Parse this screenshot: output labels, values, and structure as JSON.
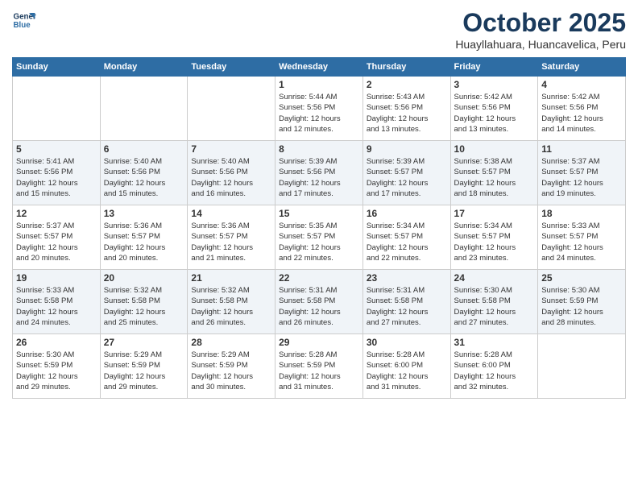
{
  "logo": {
    "line1": "General",
    "line2": "Blue"
  },
  "title": "October 2025",
  "subtitle": "Huayllahuara, Huancavelica, Peru",
  "days_of_week": [
    "Sunday",
    "Monday",
    "Tuesday",
    "Wednesday",
    "Thursday",
    "Friday",
    "Saturday"
  ],
  "weeks": [
    [
      {
        "day": "",
        "info": ""
      },
      {
        "day": "",
        "info": ""
      },
      {
        "day": "",
        "info": ""
      },
      {
        "day": "1",
        "info": "Sunrise: 5:44 AM\nSunset: 5:56 PM\nDaylight: 12 hours\nand 12 minutes."
      },
      {
        "day": "2",
        "info": "Sunrise: 5:43 AM\nSunset: 5:56 PM\nDaylight: 12 hours\nand 13 minutes."
      },
      {
        "day": "3",
        "info": "Sunrise: 5:42 AM\nSunset: 5:56 PM\nDaylight: 12 hours\nand 13 minutes."
      },
      {
        "day": "4",
        "info": "Sunrise: 5:42 AM\nSunset: 5:56 PM\nDaylight: 12 hours\nand 14 minutes."
      }
    ],
    [
      {
        "day": "5",
        "info": "Sunrise: 5:41 AM\nSunset: 5:56 PM\nDaylight: 12 hours\nand 15 minutes."
      },
      {
        "day": "6",
        "info": "Sunrise: 5:40 AM\nSunset: 5:56 PM\nDaylight: 12 hours\nand 15 minutes."
      },
      {
        "day": "7",
        "info": "Sunrise: 5:40 AM\nSunset: 5:56 PM\nDaylight: 12 hours\nand 16 minutes."
      },
      {
        "day": "8",
        "info": "Sunrise: 5:39 AM\nSunset: 5:56 PM\nDaylight: 12 hours\nand 17 minutes."
      },
      {
        "day": "9",
        "info": "Sunrise: 5:39 AM\nSunset: 5:57 PM\nDaylight: 12 hours\nand 17 minutes."
      },
      {
        "day": "10",
        "info": "Sunrise: 5:38 AM\nSunset: 5:57 PM\nDaylight: 12 hours\nand 18 minutes."
      },
      {
        "day": "11",
        "info": "Sunrise: 5:37 AM\nSunset: 5:57 PM\nDaylight: 12 hours\nand 19 minutes."
      }
    ],
    [
      {
        "day": "12",
        "info": "Sunrise: 5:37 AM\nSunset: 5:57 PM\nDaylight: 12 hours\nand 20 minutes."
      },
      {
        "day": "13",
        "info": "Sunrise: 5:36 AM\nSunset: 5:57 PM\nDaylight: 12 hours\nand 20 minutes."
      },
      {
        "day": "14",
        "info": "Sunrise: 5:36 AM\nSunset: 5:57 PM\nDaylight: 12 hours\nand 21 minutes."
      },
      {
        "day": "15",
        "info": "Sunrise: 5:35 AM\nSunset: 5:57 PM\nDaylight: 12 hours\nand 22 minutes."
      },
      {
        "day": "16",
        "info": "Sunrise: 5:34 AM\nSunset: 5:57 PM\nDaylight: 12 hours\nand 22 minutes."
      },
      {
        "day": "17",
        "info": "Sunrise: 5:34 AM\nSunset: 5:57 PM\nDaylight: 12 hours\nand 23 minutes."
      },
      {
        "day": "18",
        "info": "Sunrise: 5:33 AM\nSunset: 5:57 PM\nDaylight: 12 hours\nand 24 minutes."
      }
    ],
    [
      {
        "day": "19",
        "info": "Sunrise: 5:33 AM\nSunset: 5:58 PM\nDaylight: 12 hours\nand 24 minutes."
      },
      {
        "day": "20",
        "info": "Sunrise: 5:32 AM\nSunset: 5:58 PM\nDaylight: 12 hours\nand 25 minutes."
      },
      {
        "day": "21",
        "info": "Sunrise: 5:32 AM\nSunset: 5:58 PM\nDaylight: 12 hours\nand 26 minutes."
      },
      {
        "day": "22",
        "info": "Sunrise: 5:31 AM\nSunset: 5:58 PM\nDaylight: 12 hours\nand 26 minutes."
      },
      {
        "day": "23",
        "info": "Sunrise: 5:31 AM\nSunset: 5:58 PM\nDaylight: 12 hours\nand 27 minutes."
      },
      {
        "day": "24",
        "info": "Sunrise: 5:30 AM\nSunset: 5:58 PM\nDaylight: 12 hours\nand 27 minutes."
      },
      {
        "day": "25",
        "info": "Sunrise: 5:30 AM\nSunset: 5:59 PM\nDaylight: 12 hours\nand 28 minutes."
      }
    ],
    [
      {
        "day": "26",
        "info": "Sunrise: 5:30 AM\nSunset: 5:59 PM\nDaylight: 12 hours\nand 29 minutes."
      },
      {
        "day": "27",
        "info": "Sunrise: 5:29 AM\nSunset: 5:59 PM\nDaylight: 12 hours\nand 29 minutes."
      },
      {
        "day": "28",
        "info": "Sunrise: 5:29 AM\nSunset: 5:59 PM\nDaylight: 12 hours\nand 30 minutes."
      },
      {
        "day": "29",
        "info": "Sunrise: 5:28 AM\nSunset: 5:59 PM\nDaylight: 12 hours\nand 31 minutes."
      },
      {
        "day": "30",
        "info": "Sunrise: 5:28 AM\nSunset: 6:00 PM\nDaylight: 12 hours\nand 31 minutes."
      },
      {
        "day": "31",
        "info": "Sunrise: 5:28 AM\nSunset: 6:00 PM\nDaylight: 12 hours\nand 32 minutes."
      },
      {
        "day": "",
        "info": ""
      }
    ]
  ]
}
